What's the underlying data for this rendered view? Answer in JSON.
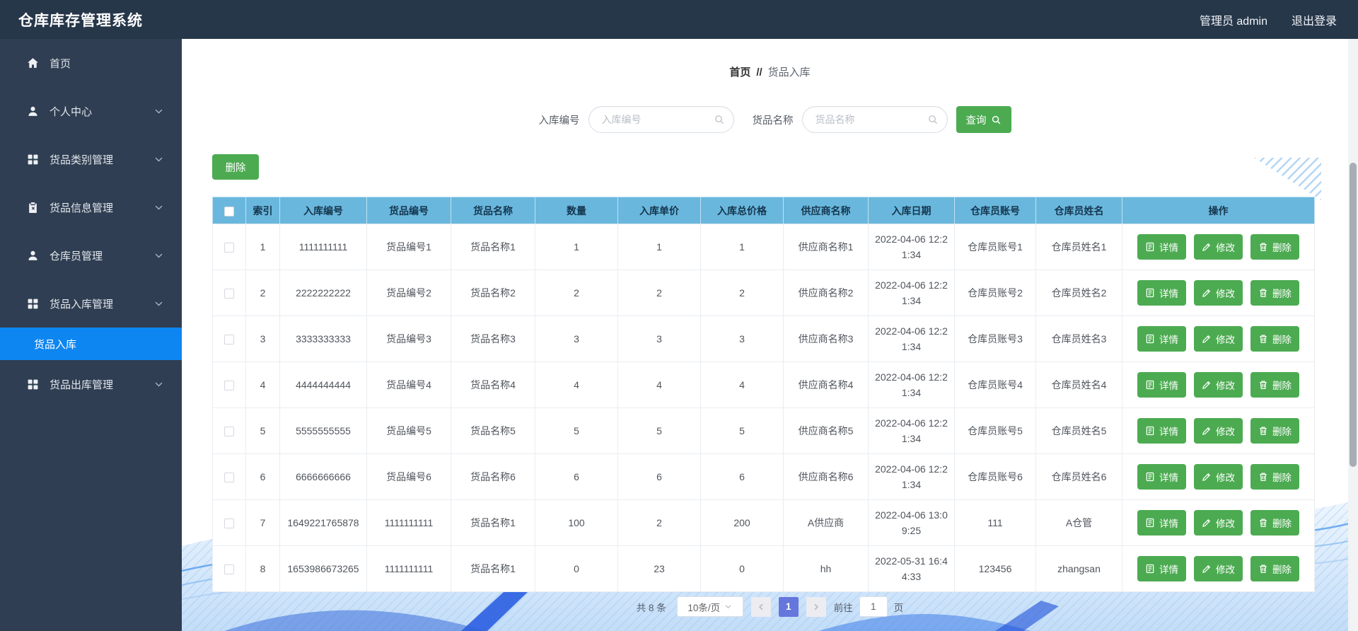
{
  "app": {
    "title": "仓库库存管理系统"
  },
  "header": {
    "user": "管理员 admin",
    "logout": "退出登录"
  },
  "sidebar": {
    "items": [
      {
        "key": "home",
        "label": "首页",
        "icon": "home-icon",
        "expandable": false
      },
      {
        "key": "personal-center",
        "label": "个人中心",
        "icon": "user-icon",
        "expandable": true
      },
      {
        "key": "goods-category-mgmt",
        "label": "货品类别管理",
        "icon": "grid-icon",
        "expandable": true
      },
      {
        "key": "goods-info-mgmt",
        "label": "货品信息管理",
        "icon": "clipboard-icon",
        "expandable": true
      },
      {
        "key": "warehouse-clerk-mgmt",
        "label": "仓库员管理",
        "icon": "user-icon",
        "expandable": true
      },
      {
        "key": "goods-inbound-mgmt",
        "label": "货品入库管理",
        "icon": "grid-icon",
        "expandable": true,
        "children": [
          {
            "key": "goods-inbound",
            "label": "货品入库",
            "active": true
          }
        ]
      },
      {
        "key": "goods-outbound-mgmt",
        "label": "货品出库管理",
        "icon": "grid-icon",
        "expandable": true
      }
    ]
  },
  "breadcrumb": {
    "home": "首页",
    "separator": "//",
    "current": "货品入库"
  },
  "search": {
    "field1_label": "入库编号",
    "field1_placeholder": "入库编号",
    "field2_label": "货品名称",
    "field2_placeholder": "货品名称",
    "submit_label": "查询"
  },
  "toolbar": {
    "delete_label": "删除"
  },
  "table": {
    "headers": [
      "索引",
      "入库编号",
      "货品编号",
      "货品名称",
      "数量",
      "入库单价",
      "入库总价格",
      "供应商名称",
      "入库日期",
      "仓库员账号",
      "仓库员姓名",
      "操作"
    ],
    "action_labels": {
      "detail": "详情",
      "edit": "修改",
      "delete": "删除"
    },
    "rows": [
      {
        "index": "1",
        "ruku_no": "1111111111",
        "goods_no": "货品编号1",
        "goods_name": "货品名称1",
        "qty": "1",
        "unit_price": "1",
        "total_price": "1",
        "supplier": "供应商名称1",
        "date": "2022-04-06 12:21:34",
        "clerk_account": "仓库员账号1",
        "clerk_name": "仓库员姓名1"
      },
      {
        "index": "2",
        "ruku_no": "2222222222",
        "goods_no": "货品编号2",
        "goods_name": "货品名称2",
        "qty": "2",
        "unit_price": "2",
        "total_price": "2",
        "supplier": "供应商名称2",
        "date": "2022-04-06 12:21:34",
        "clerk_account": "仓库员账号2",
        "clerk_name": "仓库员姓名2"
      },
      {
        "index": "3",
        "ruku_no": "3333333333",
        "goods_no": "货品编号3",
        "goods_name": "货品名称3",
        "qty": "3",
        "unit_price": "3",
        "total_price": "3",
        "supplier": "供应商名称3",
        "date": "2022-04-06 12:21:34",
        "clerk_account": "仓库员账号3",
        "clerk_name": "仓库员姓名3"
      },
      {
        "index": "4",
        "ruku_no": "4444444444",
        "goods_no": "货品编号4",
        "goods_name": "货品名称4",
        "qty": "4",
        "unit_price": "4",
        "total_price": "4",
        "supplier": "供应商名称4",
        "date": "2022-04-06 12:21:34",
        "clerk_account": "仓库员账号4",
        "clerk_name": "仓库员姓名4"
      },
      {
        "index": "5",
        "ruku_no": "5555555555",
        "goods_no": "货品编号5",
        "goods_name": "货品名称5",
        "qty": "5",
        "unit_price": "5",
        "total_price": "5",
        "supplier": "供应商名称5",
        "date": "2022-04-06 12:21:34",
        "clerk_account": "仓库员账号5",
        "clerk_name": "仓库员姓名5"
      },
      {
        "index": "6",
        "ruku_no": "6666666666",
        "goods_no": "货品编号6",
        "goods_name": "货品名称6",
        "qty": "6",
        "unit_price": "6",
        "total_price": "6",
        "supplier": "供应商名称6",
        "date": "2022-04-06 12:21:34",
        "clerk_account": "仓库员账号6",
        "clerk_name": "仓库员姓名6"
      },
      {
        "index": "7",
        "ruku_no": "1649221765878",
        "goods_no": "1111111111",
        "goods_name": "货品名称1",
        "qty": "100",
        "unit_price": "2",
        "total_price": "200",
        "supplier": "A供应商",
        "date": "2022-04-06 13:09:25",
        "clerk_account": "111",
        "clerk_name": "A仓管"
      },
      {
        "index": "8",
        "ruku_no": "1653986673265",
        "goods_no": "1111111111",
        "goods_name": "货品名称1",
        "qty": "0",
        "unit_price": "23",
        "total_price": "0",
        "supplier": "hh",
        "date": "2022-05-31 16:44:33",
        "clerk_account": "123456",
        "clerk_name": "zhangsan"
      }
    ]
  },
  "pagination": {
    "total": "共 8 条",
    "page_size": "10条/页",
    "current_page": "1",
    "goto_label": "前往",
    "goto_value": "1",
    "page_suffix": "页"
  },
  "colors": {
    "topbar_bg": "#27374a",
    "sidebar_bg": "#2f3e52",
    "active_menu": "#0d86f1",
    "table_header_bg": "#6ab7dd",
    "accent_green": "#4cab51",
    "active_page": "#6577dd"
  }
}
